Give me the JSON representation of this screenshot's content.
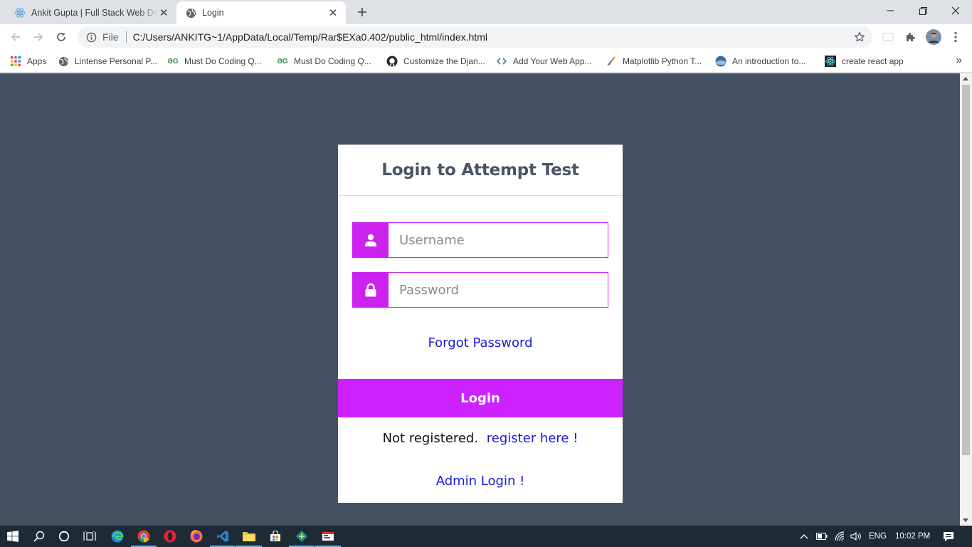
{
  "browser": {
    "tabs": [
      {
        "title": "Ankit Gupta | Full Stack Web Dev",
        "active": false
      },
      {
        "title": "Login",
        "active": true
      }
    ],
    "new_tab_icon": "plus-icon",
    "omnibox": {
      "scheme": "File",
      "url": "C:/Users/ANKITG~1/AppData/Local/Temp/Rar$EXa0.402/public_html/index.html"
    },
    "bookmarks": [
      {
        "label": "Apps",
        "icon": "apps-grid-icon"
      },
      {
        "label": "Lintense Personal P...",
        "icon": "globe-icon"
      },
      {
        "label": "Must Do Coding Q...",
        "icon": "gfg-icon"
      },
      {
        "label": "Must Do Coding Q...",
        "icon": "gfg-icon"
      },
      {
        "label": "Customize the Djan...",
        "icon": "github-icon"
      },
      {
        "label": "Add Your Web App...",
        "icon": "code-icon"
      },
      {
        "label": "Matplotlib Python T...",
        "icon": "matplotlib-icon"
      },
      {
        "label": "An introduction to...",
        "icon": "planet-icon"
      },
      {
        "label": "create react app",
        "icon": "react-icon"
      }
    ],
    "more_bookmarks": "»"
  },
  "page": {
    "background": "#435163",
    "accent": "#cc22ee",
    "card_title": "Login to Attempt Test",
    "username_placeholder": "Username",
    "password_placeholder": "Password",
    "forgot_password": "Forgot Password",
    "login_button": "Login",
    "not_registered": "Not registered.",
    "register_link": "register here !",
    "admin_login": "Admin Login !"
  },
  "taskbar": {
    "language": "ENG",
    "time": "10:02 PM"
  }
}
